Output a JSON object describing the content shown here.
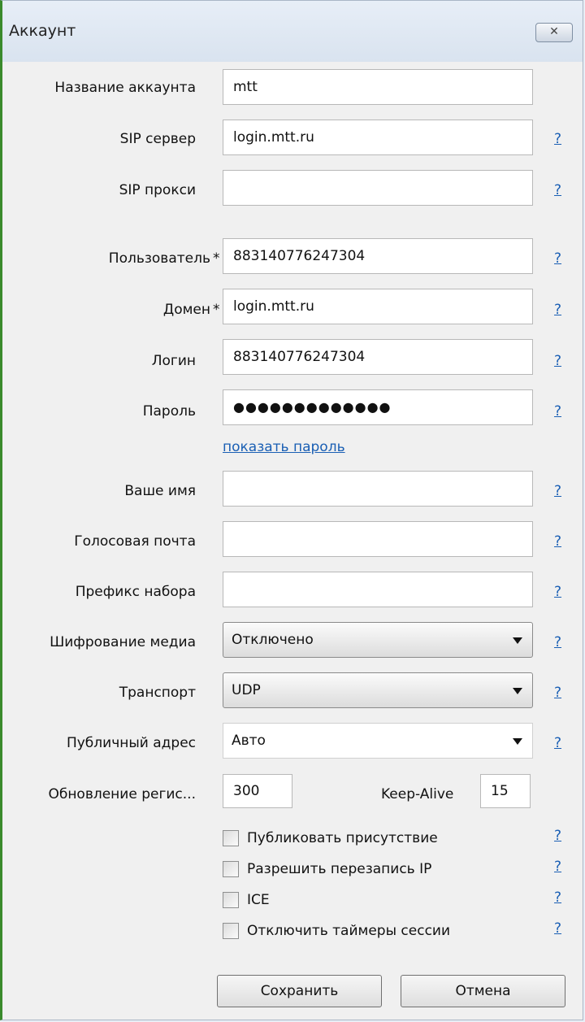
{
  "window": {
    "title": "Аккаунт",
    "close_glyph": "✕"
  },
  "fields": [
    {
      "label": "Название аккаунта",
      "value": "mtt",
      "help": false
    },
    {
      "label": "SIP сервер",
      "value": "login.mtt.ru",
      "help": true
    },
    {
      "label": "SIP прокси",
      "value": "",
      "help": true
    },
    {
      "label": "Пользователь",
      "value": "883140776247304",
      "help": true,
      "required": "*"
    },
    {
      "label": "Домен",
      "value": "login.mtt.ru",
      "help": true,
      "required": "*"
    },
    {
      "label": "Логин",
      "value": "883140776247304",
      "help": true
    },
    {
      "label": "Пароль",
      "value": "●●●●●●●●●●●●●",
      "help": true
    },
    {
      "label": "Ваше имя",
      "value": "",
      "help": true
    },
    {
      "label": "Голосовая почта",
      "value": "",
      "help": true
    },
    {
      "label": "Префикс набора",
      "value": "",
      "help": true
    }
  ],
  "show_password_link": "показать пароль",
  "help_text": "?",
  "selects": {
    "encryption": {
      "label": "Шифрование медиа",
      "value": "Отключено"
    },
    "transport": {
      "label": "Транспорт",
      "value": "UDP"
    },
    "public_address": {
      "label": "Публичный адрес",
      "value": "Авто"
    }
  },
  "registration": {
    "label": "Обновление регис...",
    "value": "300",
    "keepalive_label": "Keep-Alive",
    "keepalive_value": "15"
  },
  "checkboxes": [
    {
      "label": "Публиковать присутствие",
      "checked": false
    },
    {
      "label": "Разрешить перезапись IP",
      "checked": false
    },
    {
      "label": "ICE",
      "checked": false
    },
    {
      "label": "Отключить таймеры сессии",
      "checked": false
    }
  ],
  "buttons": {
    "save": "Сохранить",
    "cancel": "Отмена"
  },
  "colors": {
    "link": "#1a5fb4",
    "accent_border": "#3a8a2c"
  }
}
